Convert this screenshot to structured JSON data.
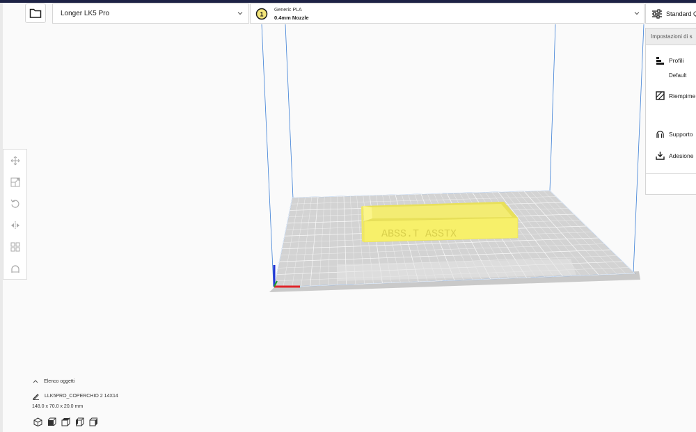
{
  "header": {
    "printer": "Longer LK5 Pro",
    "material": "Generic PLA",
    "nozzle": "0.4mm Nozzle",
    "extruder_number": "1",
    "profile": "Standard Q"
  },
  "settings_panel": {
    "title": "Impostazioni di s",
    "profiles_label": "Profili",
    "profiles_value": "Default",
    "infill_label": "Riempime",
    "support_label": "Supporto",
    "adhesion_label": "Adesione"
  },
  "toolbar": {
    "tools": [
      "move-icon",
      "scale-icon",
      "rotate-icon",
      "mirror-icon",
      "per-model-settings-icon",
      "support-blocker-icon"
    ]
  },
  "model": {
    "engraved_text": "ABSS.T ASSTX"
  },
  "object_list": {
    "toggle_label": "Elenco oggetti",
    "object_name": "LLK5PRO_COPERCHIO 2 14X14",
    "dimensions": "148.0 x 70.0 x 20.0 mm"
  },
  "view_buttons": [
    "3d-view-icon",
    "front-view-icon",
    "top-view-icon",
    "left-view-icon",
    "right-view-icon"
  ],
  "colors": {
    "accent": "#1d2245",
    "model": "#f7f06a",
    "grid_line": "#3c7fd6"
  }
}
